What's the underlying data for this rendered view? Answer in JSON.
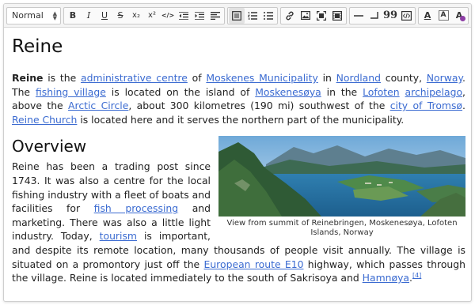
{
  "toolbar": {
    "format_select": "Normal",
    "buttons": {
      "bold": "B",
      "italic": "I",
      "underline": "U",
      "strike": "S",
      "subscript": "x₂",
      "superscript": "x²",
      "code": "</>",
      "blockquote_label": "99",
      "text_color": "A",
      "bg_color": "A",
      "clear_format": "A"
    }
  },
  "article": {
    "title": "Reine",
    "intro": [
      {
        "t": "Reine",
        "b": true
      },
      {
        "t": " is the "
      },
      {
        "t": "administrative centre",
        "link": true
      },
      {
        "t": " of "
      },
      {
        "t": "Moskenes Municipality",
        "link": true
      },
      {
        "t": " in "
      },
      {
        "t": "Nordland",
        "link": true
      },
      {
        "t": " county, "
      },
      {
        "t": "Norway",
        "link": true
      },
      {
        "t": ". The "
      },
      {
        "t": "fishing village",
        "link": true
      },
      {
        "t": " is located on the island of "
      },
      {
        "t": "Moskenesøya",
        "link": true
      },
      {
        "t": " in the "
      },
      {
        "t": "Lofoten",
        "link": true
      },
      {
        "t": " "
      },
      {
        "t": "archipelago",
        "link": true
      },
      {
        "t": ", above the "
      },
      {
        "t": "Arctic Circle",
        "link": true
      },
      {
        "t": ", about 300 kilometres (190 mi) southwest of the "
      },
      {
        "t": "city of Tromsø",
        "link": true
      },
      {
        "t": ". "
      },
      {
        "t": "Reine Church",
        "link": true
      },
      {
        "t": " is located here and it serves the northern part of the municipality."
      }
    ],
    "section_title": "Overview",
    "figure_caption": "View from summit of Reinebringen, Moskenesøya, Lofoten Islands, Norway",
    "overview": [
      {
        "t": "Reine has been a trading post since 1743. It was also a centre for the local fishing industry with a fleet of boats and facilities for "
      },
      {
        "t": "fish processing",
        "link": true
      },
      {
        "t": " and marketing. There was also a little light industry. Today, "
      },
      {
        "t": "tourism",
        "link": true
      },
      {
        "t": " is important, and despite its remote location, many thousands of people visit annually. The village is situated on a promontory just off the "
      },
      {
        "t": "European route E10",
        "link": true
      },
      {
        "t": " highway, which passes through the village. Reine is located immediately to the south of Sakrisoya and "
      },
      {
        "t": "Hamnøya",
        "link": true
      },
      {
        "t": "."
      },
      {
        "t": "[4]",
        "sup": true,
        "link": true
      }
    ]
  },
  "colors": {
    "link": "#3b6bd1",
    "toolbar_bg": "#f4f4f4",
    "bg_color_swatch": "#8e3fa6"
  }
}
